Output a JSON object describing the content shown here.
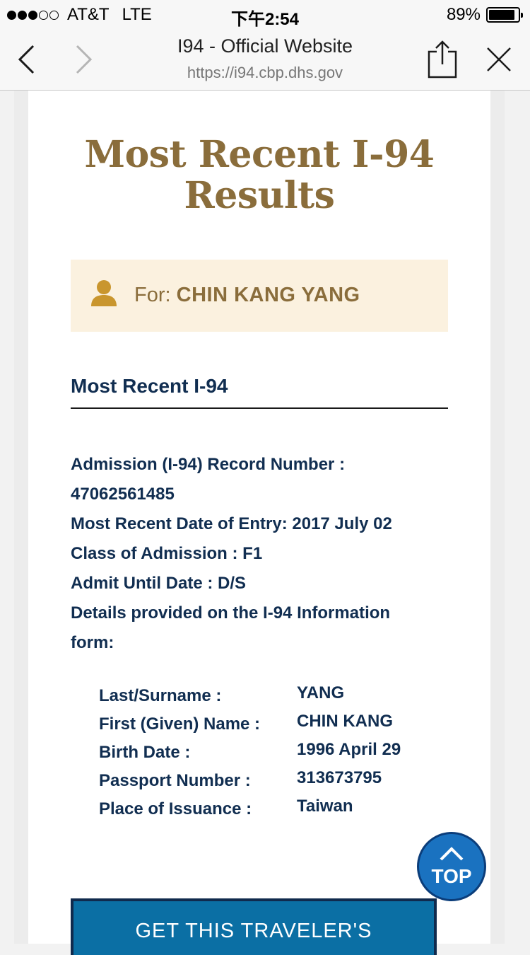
{
  "status_bar": {
    "carrier": "AT&T",
    "network": "LTE",
    "time": "下午2:54",
    "battery": "89%",
    "battery_level": 0.89,
    "signal_bars": 3
  },
  "browser": {
    "title": "I94 - Official Website",
    "url": "https://i94.cbp.dhs.gov"
  },
  "page": {
    "headline_line1": "Most Recent I-94",
    "headline_line2": "Results",
    "for_label": "For: ",
    "traveler_name": "CHIN KANG YANG",
    "section_title": "Most Recent I-94",
    "record_number_label": "Admission (I-94) Record Number :",
    "record_number": "47062561485",
    "entry_date_line": "Most Recent Date of Entry: 2017 July 02",
    "class_line": "Class of Admission : F1",
    "admit_until_line": "Admit Until Date : D/S",
    "details_line1": "Details provided on the I-94 Information",
    "details_line2": "form:",
    "info": [
      {
        "label": "Last/Surname :",
        "value": "YANG"
      },
      {
        "label": "First (Given) Name :",
        "value": "CHIN KANG"
      },
      {
        "label": "Birth Date :",
        "value": "1996 April 29"
      },
      {
        "label": "Passport Number :",
        "value": "313673795"
      },
      {
        "label": "Place of Issuance :",
        "value": "Taiwan"
      }
    ],
    "top_button": "TOP",
    "cta_button": "GET THIS TRAVELER'S"
  },
  "colors": {
    "headline": "#8a6d3b",
    "navy_text": "#112e51",
    "for_box_bg": "#fbf1df",
    "top_button": "#1a72c0",
    "cta_button": "#0b6fa4"
  }
}
